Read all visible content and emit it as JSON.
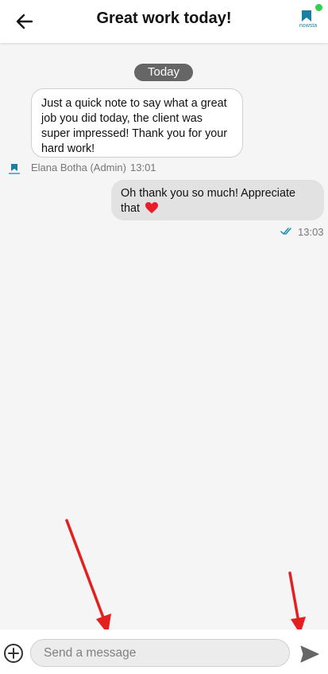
{
  "header": {
    "title": "Great work today!",
    "back_icon": "arrow-left-icon",
    "logo_text": "nowsta",
    "online_color": "#2fd14f"
  },
  "chat": {
    "date_label": "Today",
    "messages": [
      {
        "direction": "incoming",
        "text": "Just a quick note to say what a great job you did today, the client was super impressed! Thank you for your hard work!",
        "sender": "Elana Botha (Admin)",
        "time": "13:01"
      },
      {
        "direction": "outgoing",
        "text": "Oh thank you so much! Appreciate that",
        "emoji": "heart-icon",
        "status": "read",
        "time": "13:03"
      }
    ]
  },
  "composer": {
    "placeholder": "Send a message",
    "add_icon": "plus-circle-icon",
    "send_icon": "send-icon"
  },
  "colors": {
    "brand": "#1a7fa0",
    "annotation_arrow": "#e32020",
    "read_ticks": "#1a8fb0"
  }
}
